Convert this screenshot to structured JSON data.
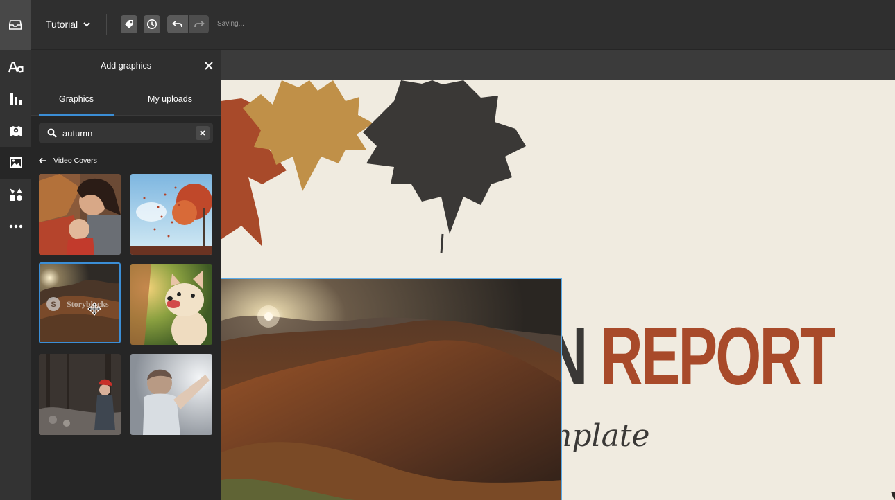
{
  "topbar": {
    "doc_title": "Tutorial",
    "status": "Saving...",
    "buttons": [
      "tag-icon",
      "history-icon",
      "undo-icon",
      "redo-icon"
    ]
  },
  "rail": {
    "items": [
      "text-icon",
      "chart-icon",
      "map-icon",
      "image-icon",
      "shapes-icon",
      "more-icon"
    ],
    "active": "image-icon"
  },
  "panel": {
    "title": "Add graphics",
    "tabs": [
      {
        "label": "Graphics",
        "active": true
      },
      {
        "label": "My uploads",
        "active": false
      }
    ],
    "search": {
      "value": "autumn"
    },
    "back_label": "Video Covers",
    "thumbnails": [
      {
        "name": "mother-child-blanket"
      },
      {
        "name": "autumn-tree-leaves"
      },
      {
        "name": "mountain-sunset",
        "watermark": "Storyblocks",
        "selected": true
      },
      {
        "name": "dog-in-sun"
      },
      {
        "name": "child-red-hat-woods"
      },
      {
        "name": "boy-reaching"
      }
    ]
  },
  "slide": {
    "title_dark": "N",
    "title_accent": "REPORT",
    "subtitle": "nplate"
  },
  "colors": {
    "accent": "#3b8ed6",
    "slide_bg": "#f0ebe0",
    "rust": "#a84a2a",
    "gold": "#c09048",
    "charcoal": "#3a3836"
  }
}
